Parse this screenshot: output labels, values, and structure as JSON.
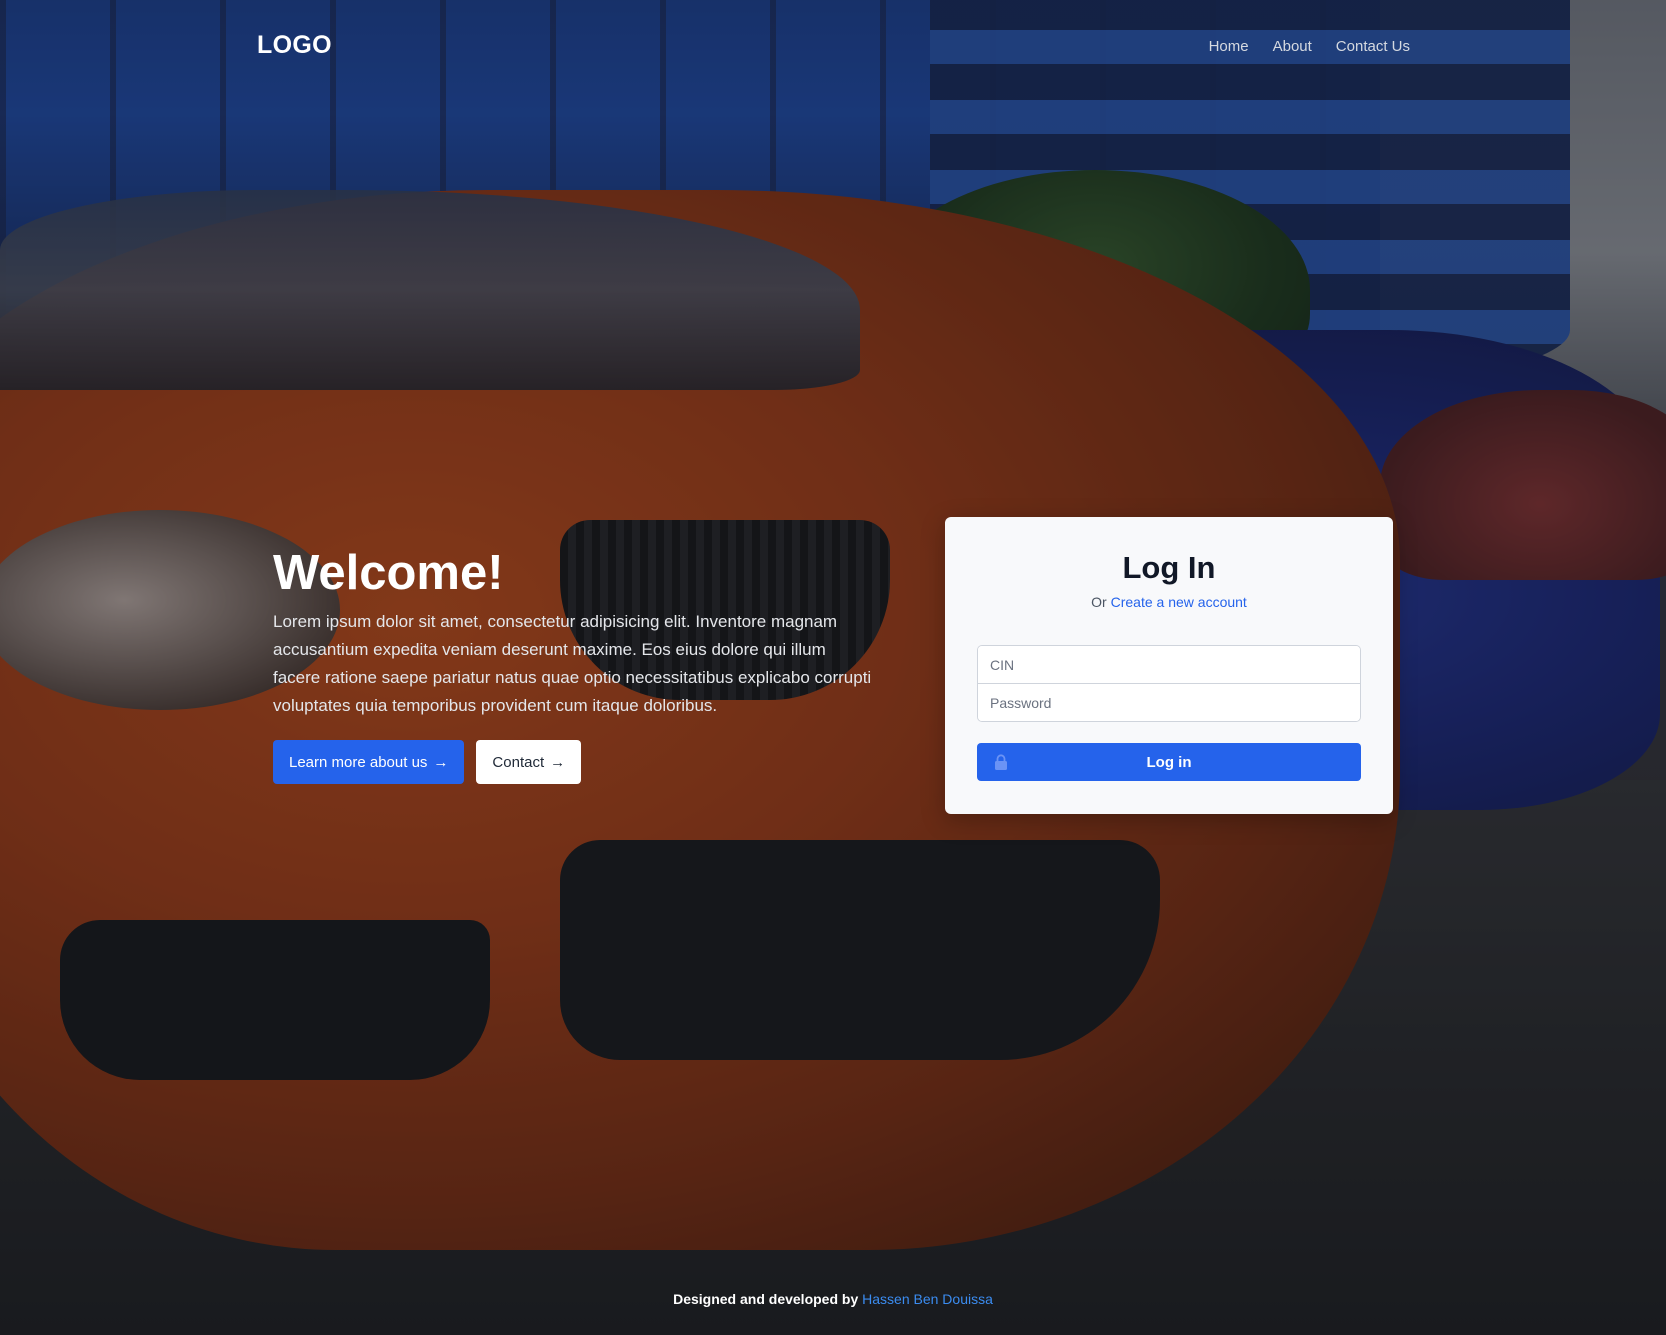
{
  "header": {
    "logo": "LOGO",
    "nav": [
      {
        "label": "Home"
      },
      {
        "label": "About"
      },
      {
        "label": "Contact Us"
      }
    ]
  },
  "hero": {
    "title": "Welcome!",
    "description": "Lorem ipsum dolor sit amet, consectetur adipisicing elit. Inventore magnam accusantium expedita veniam deserunt maxime. Eos eius dolore qui illum facere ratione saepe pariatur natus quae optio necessitatibus explicabo corrupti voluptates quia temporibus provident cum itaque doloribus.",
    "primary_button": "Learn more about us",
    "secondary_button": "Contact",
    "arrow_icon": "arrow-right-icon"
  },
  "login": {
    "title": "Log In",
    "subtitle_prefix": "Or",
    "create_account_link": "Create a new account",
    "cin_placeholder": "CIN",
    "password_placeholder": "Password",
    "submit_label": "Log in",
    "submit_icon": "lock-icon"
  },
  "footer": {
    "prefix": "Designed and developed by",
    "author": "Hassen Ben Douissa"
  },
  "colors": {
    "accent": "#2563eb",
    "link": "#3b8cf0",
    "card_bg": "#f8f9fb"
  }
}
